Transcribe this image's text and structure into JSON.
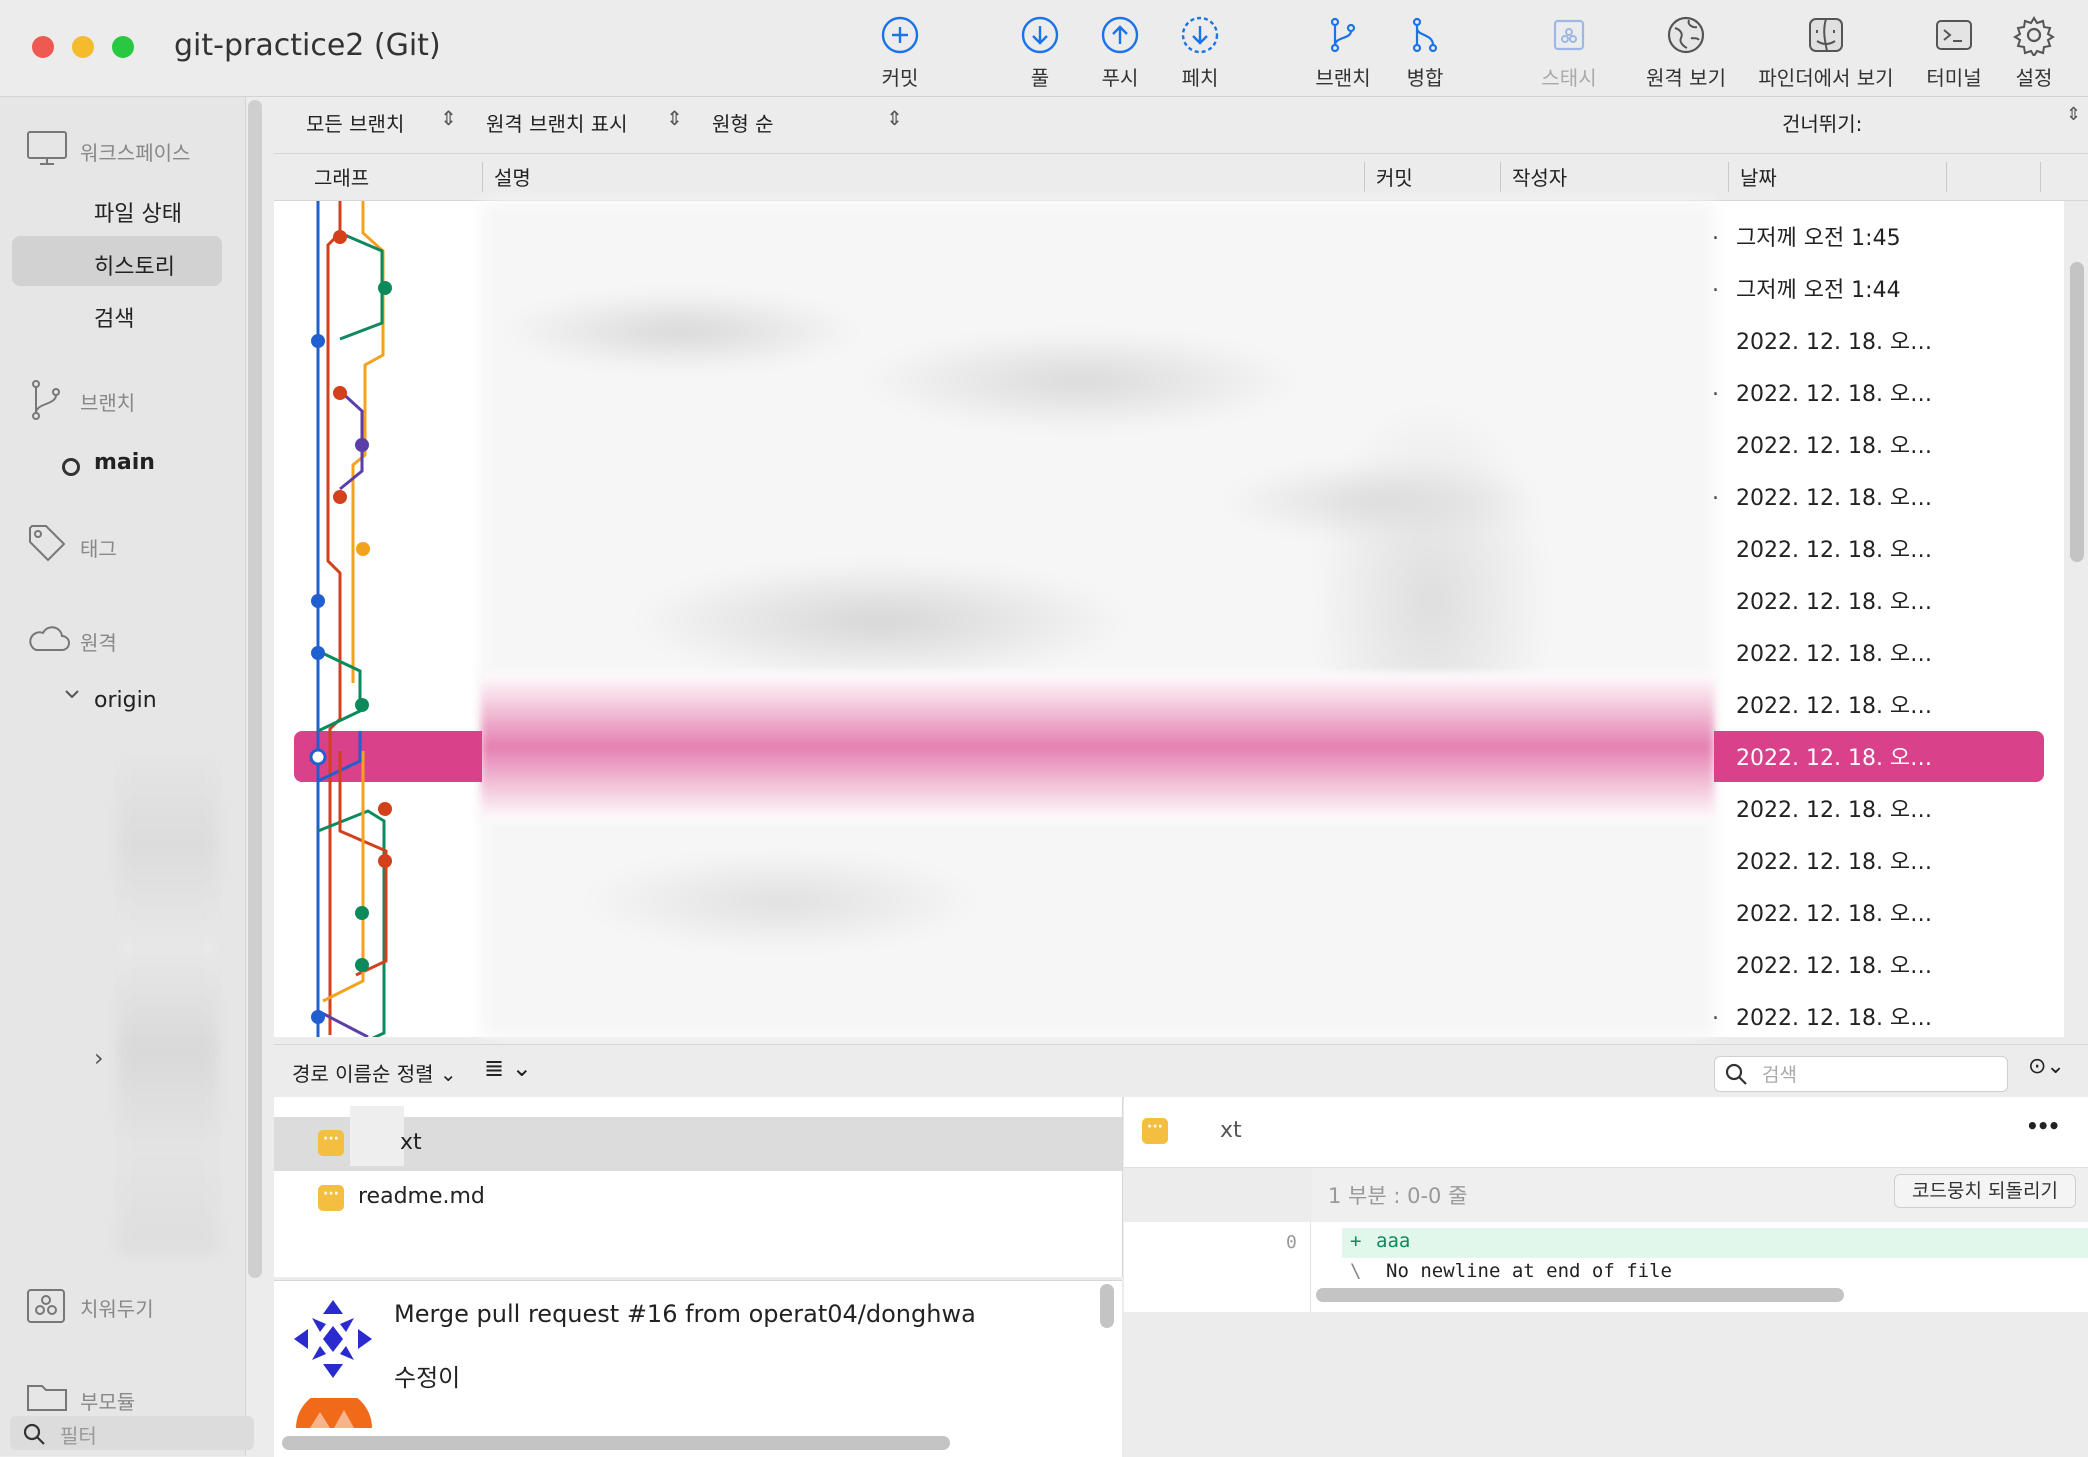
{
  "window": {
    "title": "git-practice2 (Git)"
  },
  "toolbar": [
    {
      "label": "커밋",
      "icon": "plus-circle-icon",
      "disabled": false
    },
    {
      "label": "풀",
      "icon": "pull-icon",
      "disabled": false
    },
    {
      "label": "푸시",
      "icon": "push-icon",
      "disabled": false
    },
    {
      "label": "페치",
      "icon": "fetch-icon",
      "disabled": false
    },
    {
      "label": "브랜치",
      "icon": "branch-icon",
      "disabled": false
    },
    {
      "label": "병합",
      "icon": "merge-icon",
      "disabled": false
    },
    {
      "label": "스태시",
      "icon": "stash-icon",
      "disabled": true
    },
    {
      "label": "원격 보기",
      "icon": "globe-icon",
      "disabled": false
    },
    {
      "label": "파인더에서 보기",
      "icon": "finder-icon",
      "disabled": false
    },
    {
      "label": "터미널",
      "icon": "terminal-icon",
      "disabled": false
    },
    {
      "label": "설정",
      "icon": "gear-icon",
      "disabled": false
    }
  ],
  "sidebar": {
    "workspace": "워크스페이스",
    "workspace_items": [
      "파일 상태",
      "히스토리",
      "검색"
    ],
    "selected": "히스토리",
    "branches": "브랜치",
    "branch_main": "main",
    "tags": "태그",
    "remotes": "원격",
    "remote_origin": "origin",
    "stashes": "치워두기",
    "submodules": "부모듈",
    "filter_placeholder": "필터",
    "expand_chevron": "›"
  },
  "filterbar": {
    "branches": "모든 브랜치",
    "remote": "원격 브랜치 표시",
    "order": "원형 순",
    "jump": "건너뛰기:"
  },
  "columns": {
    "graph": "그래프",
    "desc": "설명",
    "commit": "커밋",
    "author": "작성자",
    "date": "날짜"
  },
  "rows": [
    {
      "date": "그저께 오전 1:45",
      "dot": true
    },
    {
      "date": "그저께 오전 1:44",
      "dot": true
    },
    {
      "date": "2022. 12. 18. 오…",
      "dot": false
    },
    {
      "date": "2022. 12. 18. 오…",
      "dot": true
    },
    {
      "date": "2022. 12. 18. 오…",
      "dot": false
    },
    {
      "date": "2022. 12. 18. 오…",
      "dot": true
    },
    {
      "date": "2022. 12. 18. 오…",
      "dot": false
    },
    {
      "date": "2022. 12. 18. 오…",
      "dot": false
    },
    {
      "date": "2022. 12. 18. 오…",
      "dot": false
    },
    {
      "date": "2022. 12. 18. 오…",
      "dot": false
    },
    {
      "date": "2022. 12. 18. 오…",
      "dot": false,
      "selected": true
    },
    {
      "date": "2022. 12. 18. 오…",
      "dot": false
    },
    {
      "date": "2022. 12. 18. 오…",
      "dot": false
    },
    {
      "date": "2022. 12. 18. 오…",
      "dot": false
    },
    {
      "date": "2022. 12. 18. 오…",
      "dot": false
    },
    {
      "date": "2022. 12. 18. 오…",
      "dot": true
    }
  ],
  "bottom": {
    "sort": "경로 이름순 정렬",
    "search_placeholder": "검색",
    "files": [
      {
        "name": "xt",
        "selected": true
      },
      {
        "name": "readme.md",
        "selected": false
      }
    ],
    "commit_title": "Merge pull request #16 from operat04/donghwa",
    "commit_body": "수정이",
    "diff_file": "xt",
    "hunk": "1 부분 : 0-0 줄",
    "revert": "코드뭉치 되돌리기",
    "line_no": "0",
    "add_mark": "+",
    "add_text": "aaa",
    "nonl_mark": "\\",
    "nonl_text": "No newline at end of file",
    "more": "•••"
  },
  "colors": {
    "selection": "#d9418a",
    "blue": "#1f5fcf",
    "red": "#d2401c",
    "green": "#0d8a5c",
    "orange": "#f4a21c",
    "purple": "#5a3eaa",
    "file_badge": "#f4be40"
  }
}
